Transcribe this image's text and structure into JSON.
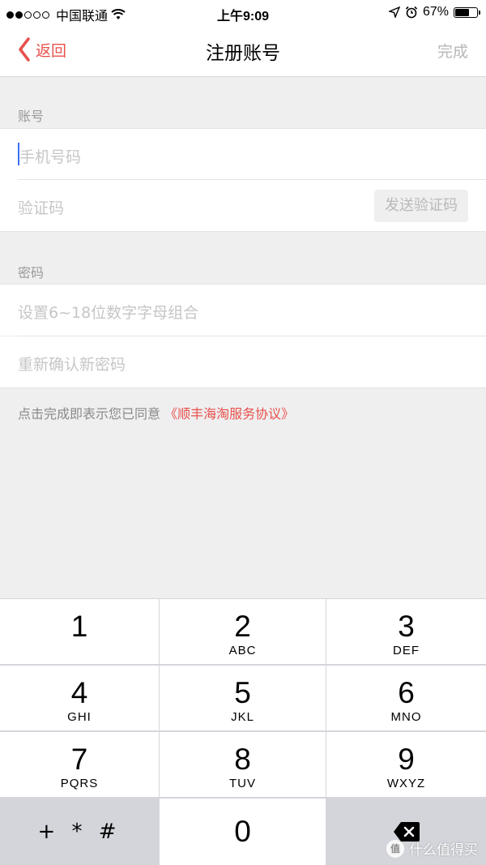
{
  "status": {
    "carrier": "中国联通",
    "time": "上午9:09",
    "battery": "67%",
    "battery_level": 0.67
  },
  "nav": {
    "back_label": "返回",
    "title": "注册账号",
    "done_label": "完成"
  },
  "account": {
    "section_label": "账号",
    "phone_placeholder": "手机号码",
    "code_placeholder": "验证码",
    "send_code_label": "发送验证码"
  },
  "password": {
    "section_label": "密码",
    "password_placeholder": "设置6~18位数字字母组合",
    "confirm_placeholder": "重新确认新密码"
  },
  "agreement": {
    "prefix": "点击完成即表示您已同意",
    "link": "《顺丰海淘服务协议》"
  },
  "keypad": {
    "keys": [
      {
        "num": "1",
        "letters": ""
      },
      {
        "num": "2",
        "letters": "ABC"
      },
      {
        "num": "3",
        "letters": "DEF"
      },
      {
        "num": "4",
        "letters": "GHI"
      },
      {
        "num": "5",
        "letters": "JKL"
      },
      {
        "num": "6",
        "letters": "MNO"
      },
      {
        "num": "7",
        "letters": "PQRS"
      },
      {
        "num": "8",
        "letters": "TUV"
      },
      {
        "num": "9",
        "letters": "WXYZ"
      },
      {
        "num": "0",
        "letters": ""
      }
    ],
    "symbols_label": "+ * #"
  },
  "watermark": {
    "text": "什么值得买",
    "logo_text": "值"
  }
}
